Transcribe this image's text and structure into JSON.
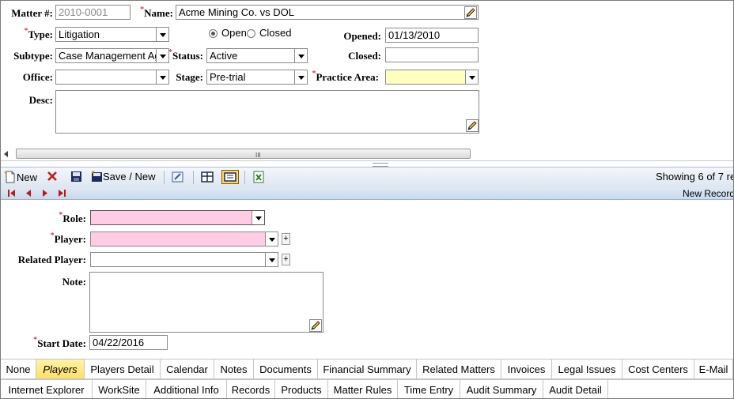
{
  "matter": {
    "matter_no_label": "Matter #:",
    "matter_no_value": "2010-0001",
    "name_label": "Name:",
    "name_value": "Acme Mining Co. vs DOL",
    "type_label": "Type:",
    "type_value": "Litigation",
    "status_radio_open": "Open",
    "status_radio_closed": "Closed",
    "opened_label": "Opened:",
    "opened_value": "01/13/2010",
    "subtype_label": "Subtype:",
    "subtype_value": "Case Management Ag",
    "status_label": "Status:",
    "status_value": "Active",
    "closed_label": "Closed:",
    "closed_value": "",
    "office_label": "Office:",
    "office_value": "",
    "stage_label": "Stage:",
    "stage_value": "Pre-trial",
    "practice_area_label": "Practice Area:",
    "practice_area_value": "",
    "desc_label": "Desc:",
    "desc_value": "",
    "required_marker": "*",
    "scroll_grip": "III"
  },
  "toolbar": {
    "new_label": "New",
    "save_new_label": "Save / New",
    "showing_text": "Showing 6 of 7 re"
  },
  "navbar": {
    "new_record_text": "New Record"
  },
  "player_form": {
    "role_label": "Role:",
    "role_value": "",
    "player_label": "Player:",
    "player_value": "",
    "related_player_label": "Related Player:",
    "related_player_value": "",
    "note_label": "Note:",
    "note_value": "",
    "start_date_label": "Start Date:",
    "start_date_value": "04/22/2016",
    "plus_label": "+"
  },
  "tabs_row1": [
    "None",
    "Players",
    "Players Detail",
    "Calendar",
    "Notes",
    "Documents",
    "Financial Summary",
    "Related Matters",
    "Invoices",
    "Legal Issues",
    "Cost Centers",
    "E-Mail"
  ],
  "tabs_row2": [
    "Internet Explorer",
    "WorkSite",
    "Additional Info",
    "Records",
    "Products",
    "Matter Rules",
    "Time Entry",
    "Audit Summary",
    "Audit Detail"
  ],
  "active_tab": "Players",
  "colors": {
    "required_field_yellow": "#ffffc0",
    "required_field_pink": "#ffcce6",
    "active_tab": "#ffe066",
    "toolbar_blue": "#dde6f1"
  }
}
